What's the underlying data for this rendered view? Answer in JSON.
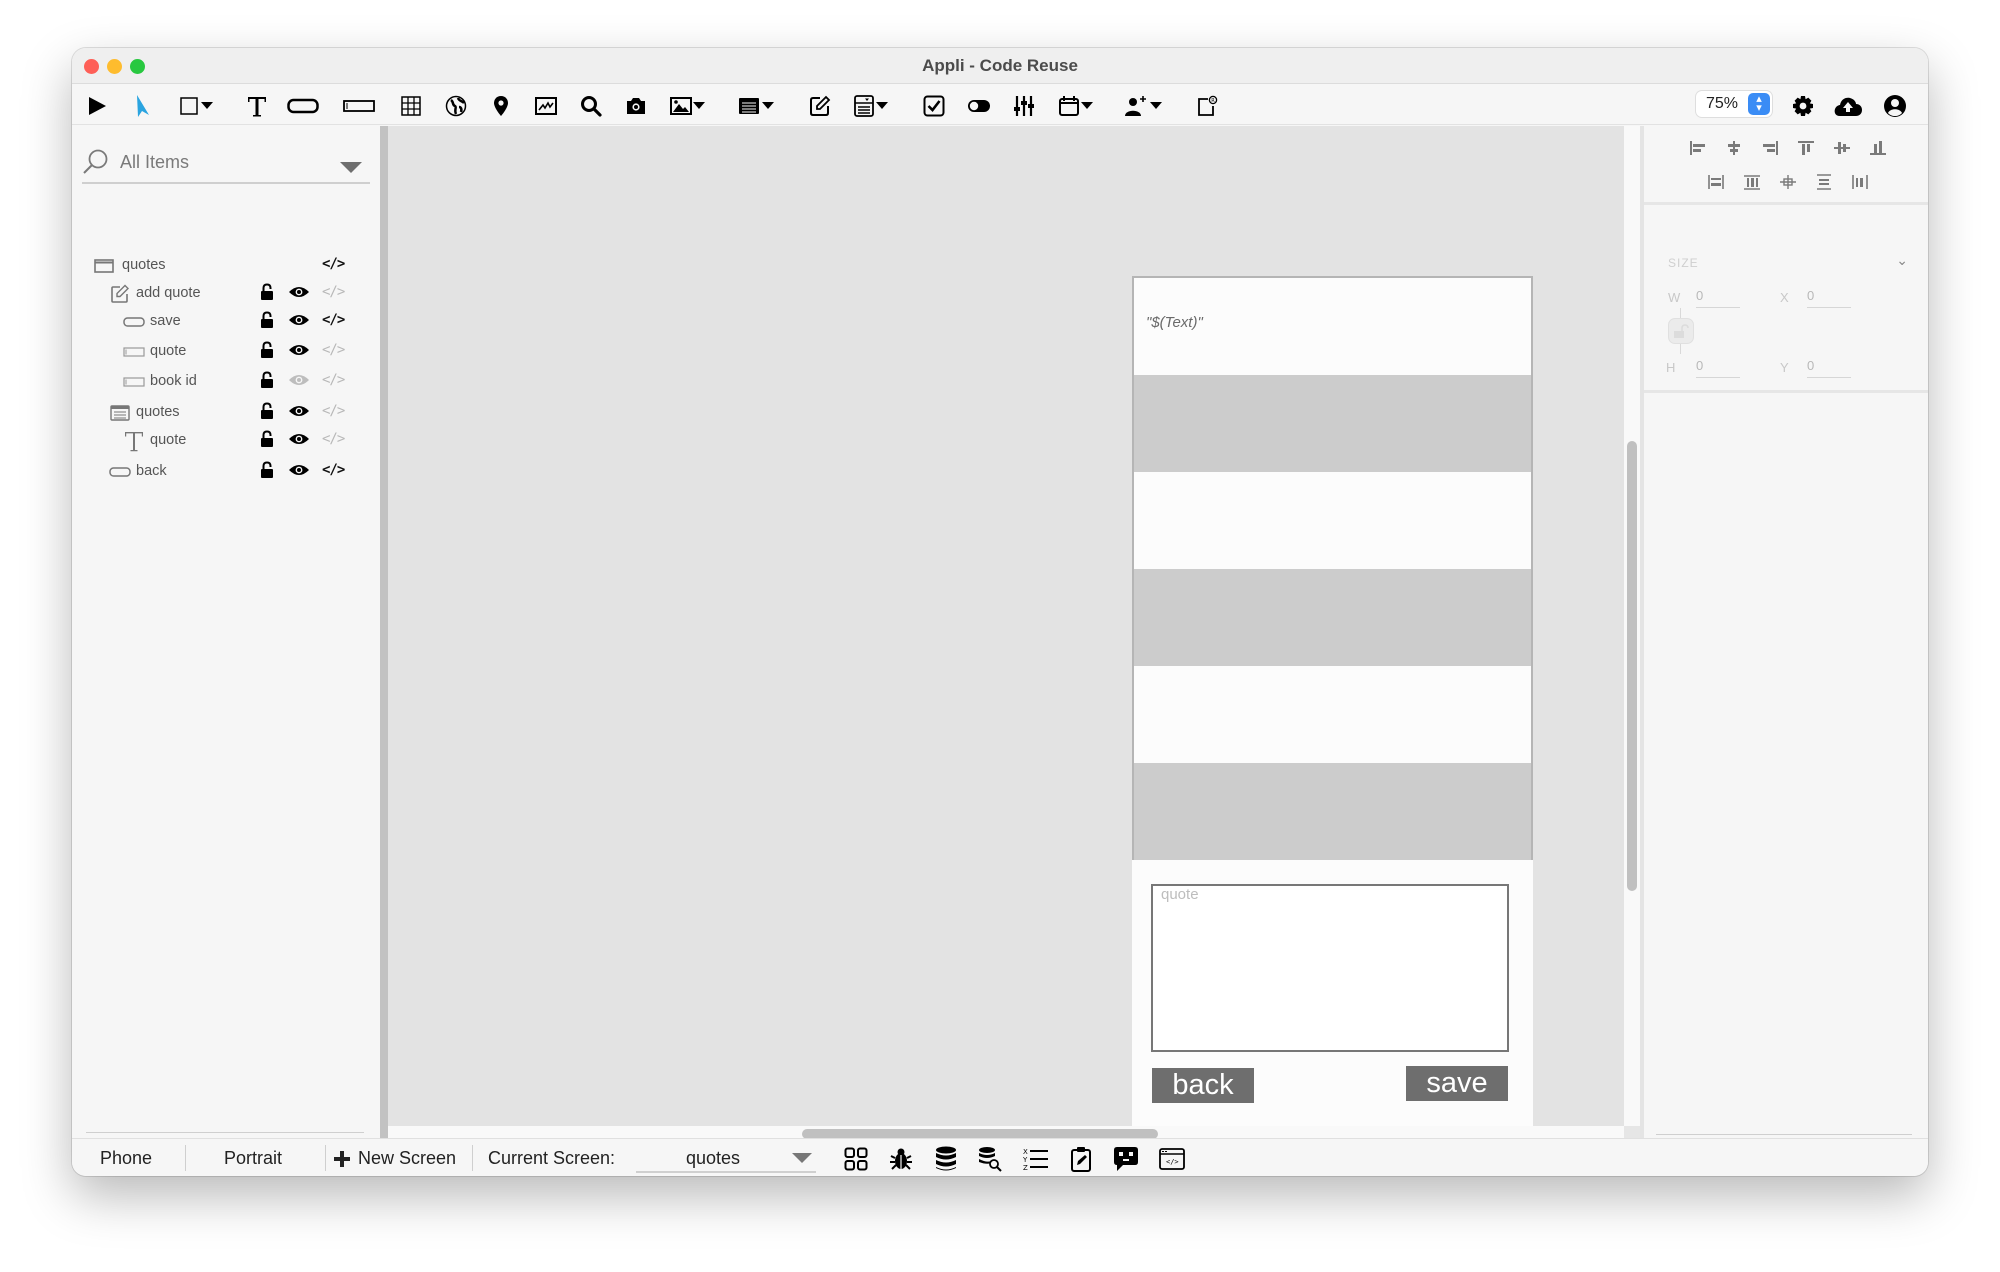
{
  "window": {
    "title": "Appli - Code Reuse"
  },
  "toolbar": {
    "tools": [
      {
        "name": "run",
        "icon": "play-icon"
      },
      {
        "name": "select",
        "icon": "pointer-arrow-icon",
        "active": true
      },
      {
        "name": "rectangle",
        "icon": "rectangle-icon",
        "dropdown": true
      },
      {
        "name": "text",
        "icon": "text-t-icon"
      },
      {
        "name": "button",
        "icon": "button-shape-icon"
      },
      {
        "name": "text-field",
        "icon": "text-field-icon"
      },
      {
        "name": "table",
        "icon": "grid-table-icon"
      },
      {
        "name": "web-view",
        "icon": "globe-icon"
      },
      {
        "name": "map",
        "icon": "map-pin-icon"
      },
      {
        "name": "chart",
        "icon": "chart-icon"
      },
      {
        "name": "search",
        "icon": "magnifier-icon"
      },
      {
        "name": "camera",
        "icon": "camera-icon"
      },
      {
        "name": "image",
        "icon": "image-icon",
        "dropdown": true
      },
      {
        "name": "list",
        "icon": "list-icon",
        "dropdown": true
      },
      {
        "name": "form",
        "icon": "edit-form-icon"
      },
      {
        "name": "picker",
        "icon": "picker-icon",
        "dropdown": true
      },
      {
        "name": "checkbox",
        "icon": "checkbox-icon"
      },
      {
        "name": "toggle",
        "icon": "toggle-icon"
      },
      {
        "name": "slider",
        "icon": "sliders-icon"
      },
      {
        "name": "date",
        "icon": "calendar-icon",
        "dropdown": true
      },
      {
        "name": "user",
        "icon": "add-user-icon",
        "dropdown": true
      },
      {
        "name": "custom",
        "icon": "custom-component-icon"
      }
    ],
    "zoom_level": "75%",
    "right_icons": [
      "gear-icon",
      "cloud-upload-icon",
      "account-icon"
    ]
  },
  "sidebar": {
    "filter_label": "All Items",
    "tree": [
      {
        "label": "quotes",
        "icon": "screen-icon",
        "depth": 0,
        "lock": false,
        "eye": null,
        "code_active": true
      },
      {
        "label": "add quote",
        "icon": "form-edit-icon",
        "depth": 1,
        "lock": true,
        "eye": "visible",
        "code_active": false
      },
      {
        "label": "save",
        "icon": "button-icon",
        "depth": 2,
        "lock": true,
        "eye": "visible",
        "code_active": true
      },
      {
        "label": "quote",
        "icon": "textfield-icon",
        "depth": 2,
        "lock": true,
        "eye": "visible",
        "code_active": false
      },
      {
        "label": "book id",
        "icon": "textfield-icon",
        "depth": 2,
        "lock": true,
        "eye": "hidden",
        "code_active": false
      },
      {
        "label": "quotes",
        "icon": "list-icon",
        "depth": 1,
        "lock": true,
        "eye": "visible",
        "code_active": false
      },
      {
        "label": "quote",
        "icon": "text-icon",
        "depth": 2,
        "lock": true,
        "eye": "visible",
        "code_active": false
      },
      {
        "label": "back",
        "icon": "button-icon",
        "depth": 1,
        "lock": true,
        "eye": "visible",
        "code_active": true
      }
    ],
    "code_glyph": "</>"
  },
  "canvas": {
    "list_cell_text": "\"$(Text)\"",
    "list_rows": 6,
    "textarea_placeholder": "quote",
    "back_label": "back",
    "save_label": "save"
  },
  "inspector": {
    "size_section": "SIZE",
    "w_label": "W",
    "w_value": "0",
    "h_label": "H",
    "h_value": "0",
    "x_label": "X",
    "x_value": "0",
    "y_label": "Y",
    "y_value": "0"
  },
  "bottombar": {
    "device": "Phone",
    "orientation": "Portrait",
    "new_screen": "New Screen",
    "current_screen_label": "Current Screen:",
    "current_screen_value": "quotes"
  },
  "colors": {
    "accent": "#2aa4e0",
    "zoom_stepper": "#3a8cf5",
    "button_fill": "#6e6e6e",
    "alt_row": "#cccccc"
  }
}
